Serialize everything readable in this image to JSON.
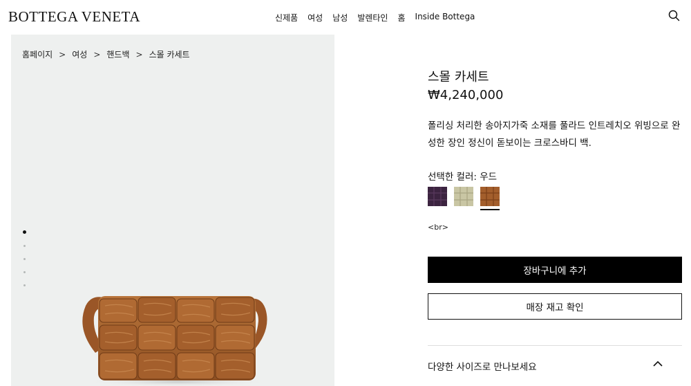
{
  "header": {
    "logo": "BOTTEGA VENETA",
    "nav": [
      "신제품",
      "여성",
      "남성",
      "발렌타인",
      "홈",
      "Inside Bottega"
    ],
    "search_icon": "search-icon"
  },
  "breadcrumb": {
    "items": [
      "홈페이지",
      "여성",
      "핸드백",
      "스몰 카세트"
    ],
    "separator": ">"
  },
  "gallery": {
    "image_count": 5,
    "active_index": 0
  },
  "product": {
    "title": "스몰 카세트",
    "price": "₩4,240,000",
    "description": "폴리싱 처리한 송아지가죽 소재를 풀라드 인트레치오 위빙으로 완성한 장인 정신이 돋보이는 크로스바디 백.",
    "color_label": "선택한 컬러: 우드",
    "swatches": [
      {
        "name": "purple",
        "color": "#3c2440"
      },
      {
        "name": "sage",
        "color": "#c9c6a4"
      },
      {
        "name": "wood",
        "color": "#a35e2c",
        "selected": true
      }
    ],
    "br_text": "<br>",
    "add_to_cart": "장바구니에 추가",
    "check_store": "매장 재고 확인",
    "sizes_accordion": "다양한 사이즈로 만나보세요"
  },
  "colors": {
    "gallery_bg": "#eef0ef",
    "cart_button_bg": "#000000",
    "bag_leather": "#a4622d"
  }
}
